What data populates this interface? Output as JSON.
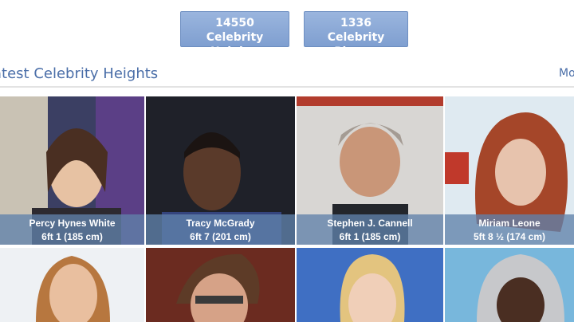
{
  "stats": {
    "heights": {
      "count": "14550",
      "label": "Celebrity Heights"
    },
    "photos": {
      "count": "1336",
      "label": "Celebrity Photos"
    }
  },
  "section": {
    "title": "atest Celebrity Heights",
    "more": "Mo"
  },
  "cards": [
    {
      "name": "Percy Hynes White",
      "height": "6ft 1 (185 cm)"
    },
    {
      "name": "Tracy McGrady",
      "height": "6ft 7 (201 cm)"
    },
    {
      "name": "Stephen J. Cannell",
      "height": "6ft 1 (185 cm)"
    },
    {
      "name": "Miriam Leone",
      "height": "5ft 8 ½ (174 cm)"
    }
  ],
  "colors": {
    "accent": "#4a6ea8",
    "button": "#8fabd8",
    "caption": "#6082aa"
  }
}
